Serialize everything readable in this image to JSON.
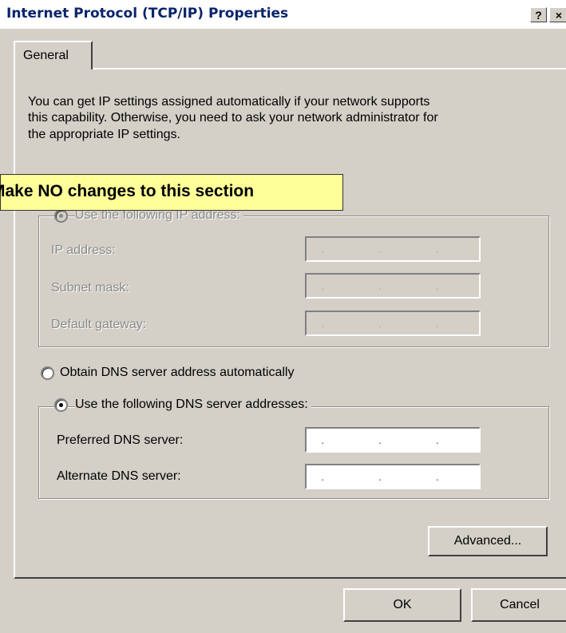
{
  "window": {
    "title": "Internet Protocol (TCP/IP) Properties",
    "help_label": "?",
    "close_label": "×"
  },
  "tabs": [
    {
      "label": "General"
    }
  ],
  "intro_text": [
    "You can get IP settings assigned automatically if your network supports",
    "this capability. Otherwise, you need to ask your network administrator for",
    "the appropriate IP settings."
  ],
  "callout": {
    "text": "Make NO changes to this section"
  },
  "ip_section": {
    "radio_label": "Use the following IP address:",
    "fields": [
      {
        "label": "IP address:",
        "value": ". . ."
      },
      {
        "label": "Subnet mask:",
        "value": ". . ."
      },
      {
        "label": "Default gateway:",
        "value": ". . ."
      }
    ]
  },
  "dns_section": {
    "auto_label": "Obtain DNS server address automatically",
    "manual_label": "Use the following DNS server addresses:",
    "selected": "manual",
    "fields": [
      {
        "label": "Preferred DNS server:",
        "value": ". . ."
      },
      {
        "label": "Alternate DNS server:",
        "value": ". . ."
      }
    ]
  },
  "buttons": {
    "advanced": "Advanced...",
    "ok": "OK",
    "cancel": "Cancel"
  }
}
